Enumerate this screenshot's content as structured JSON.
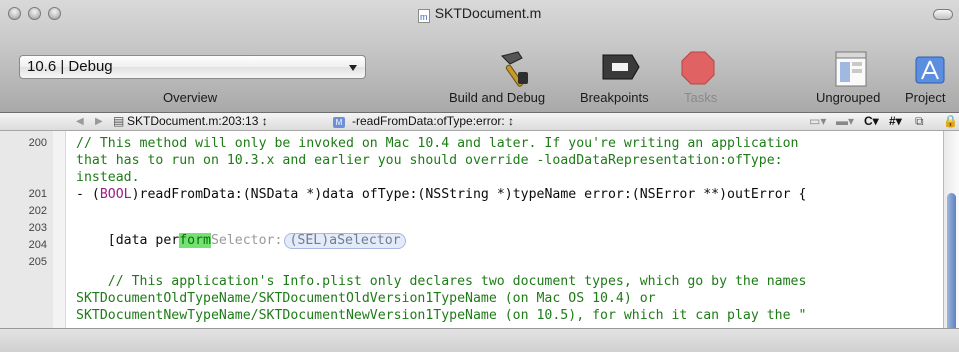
{
  "window": {
    "title": "SKTDocument.m"
  },
  "toolbar": {
    "overview_value": "10.6 | Debug",
    "overview_label": "Overview",
    "build_label": "Build and Debug",
    "breakpoints_label": "Breakpoints",
    "tasks_label": "Tasks",
    "ungrouped_label": "Ungrouped",
    "project_label": "Project"
  },
  "navbar": {
    "file_position": "SKTDocument.m:203:13 ↕",
    "method": "-readFromData:ofType:error: ↕",
    "c_button": "C",
    "hash_button": "#"
  },
  "editor": {
    "lines": [
      {
        "num": "200",
        "text": "// This method will only be invoked on Mac 10.4 and later. If you're writing an application"
      },
      {
        "num": "",
        "text": "that has to run on 10.3.x and earlier you should override -loadDataRepresentation:ofType:"
      },
      {
        "num": "",
        "text": "instead."
      },
      {
        "num": "201",
        "text_a": "- (",
        "text_kw": "BOOL",
        "text_b": ")readFromData:(NSData *)data ofType:(NSString *)typeName error:(NSError **)outError {"
      },
      {
        "num": "202",
        "text": ""
      },
      {
        "num": "203",
        "code_a": "    [data per",
        "code_hl": "form",
        "code_ph": "Selector:",
        "code_tok": "(SEL)aSelector"
      },
      {
        "num": "204",
        "text": ""
      },
      {
        "num": "205",
        "text": "    // This application's Info.plist only declares two document types, which go by the names"
      },
      {
        "num": "",
        "text": "SKTDocumentOldTypeName/SKTDocumentOldVersion1TypeName (on Mac OS 10.4) or"
      },
      {
        "num": "",
        "text": "SKTDocumentNewTypeName/SKTDocumentNewVersion1TypeName (on 10.5), for which it can play the \""
      }
    ]
  }
}
